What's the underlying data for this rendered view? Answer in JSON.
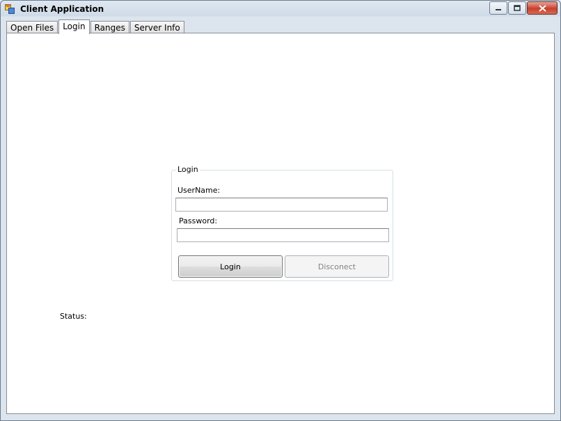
{
  "window": {
    "title": "Client Application"
  },
  "tabs": [
    {
      "label": "Open Files"
    },
    {
      "label": "Login"
    },
    {
      "label": "Ranges"
    },
    {
      "label": "Server Info"
    }
  ],
  "active_tab": "Login",
  "login_group": {
    "legend": "Login",
    "username_label": "UserName:",
    "username_value": "",
    "password_label": "Password:",
    "password_value": "",
    "login_button": "Login",
    "disconnect_button": "Disconect"
  },
  "status": {
    "label": "Status:"
  },
  "icons": {
    "app": "app-window-icon",
    "minimize": "minimize-icon",
    "maximize": "maximize-icon",
    "close": "close-icon"
  },
  "colors": {
    "close_button": "#c8402c",
    "panel_bg": "#ffffff",
    "chrome_bg": "#cfdbe8"
  }
}
